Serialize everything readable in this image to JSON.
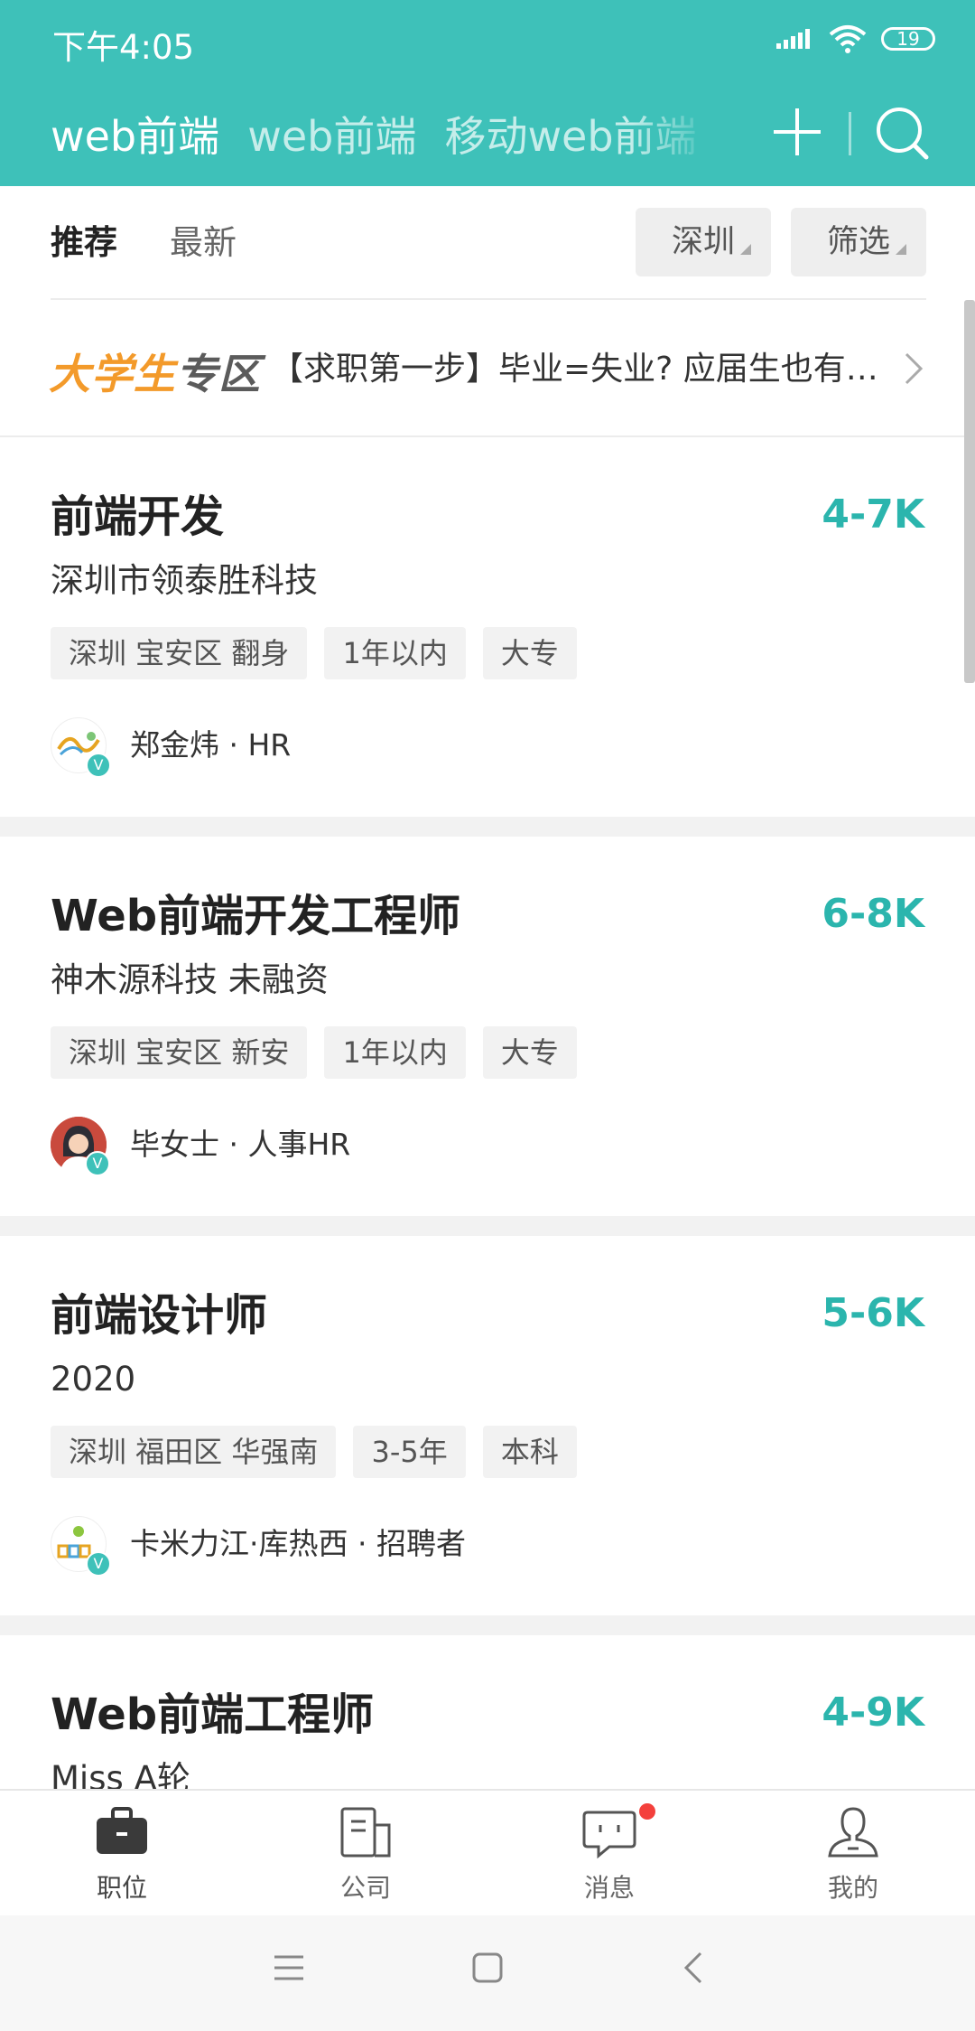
{
  "status_bar": {
    "time": "下午4:05",
    "battery": "19"
  },
  "header": {
    "tabs": [
      {
        "label": "web前端",
        "active": true
      },
      {
        "label": "web前端",
        "active": false
      },
      {
        "label": "移动web前端",
        "active": false
      }
    ],
    "icons": [
      "plus-icon",
      "search-icon"
    ]
  },
  "sort_bar": {
    "tabs": [
      {
        "label": "推荐",
        "active": true
      },
      {
        "label": "最新",
        "active": false
      }
    ],
    "city": "深圳",
    "filter": "筛选"
  },
  "banner": {
    "logo_part1": "大学生",
    "logo_part2": "专区",
    "text": "【求职第一步】毕业=失业? 应届生也有…"
  },
  "jobs": [
    {
      "title": "前端开发",
      "salary": "4-7K",
      "company": "深圳市领泰胜科技",
      "tags": [
        "深圳 宝安区 翻身",
        "1年以内",
        "大专"
      ],
      "recruiter": "郑金炜 · HR",
      "avatar_badge": "V"
    },
    {
      "title": "Web前端开发工程师",
      "salary": "6-8K",
      "company": "神木源科技  未融资",
      "tags": [
        "深圳 宝安区 新安",
        "1年以内",
        "大专"
      ],
      "recruiter": "毕女士 · 人事HR",
      "avatar_badge": "V"
    },
    {
      "title": "前端设计师",
      "salary": "5-6K",
      "company": "2020",
      "tags": [
        "深圳 福田区 华强南",
        "3-5年",
        "本科"
      ],
      "recruiter": "卡米力江·库热西 · 招聘者",
      "avatar_badge": "V"
    },
    {
      "title": "Web前端工程师",
      "salary": "4-9K",
      "company": "Miss  A轮"
    }
  ],
  "bottom_nav": [
    {
      "label": "职位",
      "icon": "briefcase-icon",
      "active": true
    },
    {
      "label": "公司",
      "icon": "company-icon",
      "active": false
    },
    {
      "label": "消息",
      "icon": "message-icon",
      "active": false,
      "has_dot": true
    },
    {
      "label": "我的",
      "icon": "profile-icon",
      "active": false
    }
  ],
  "colors": {
    "accent": "#3ec1b9",
    "salary": "#2bb5ad",
    "badge": "#f4403c"
  }
}
